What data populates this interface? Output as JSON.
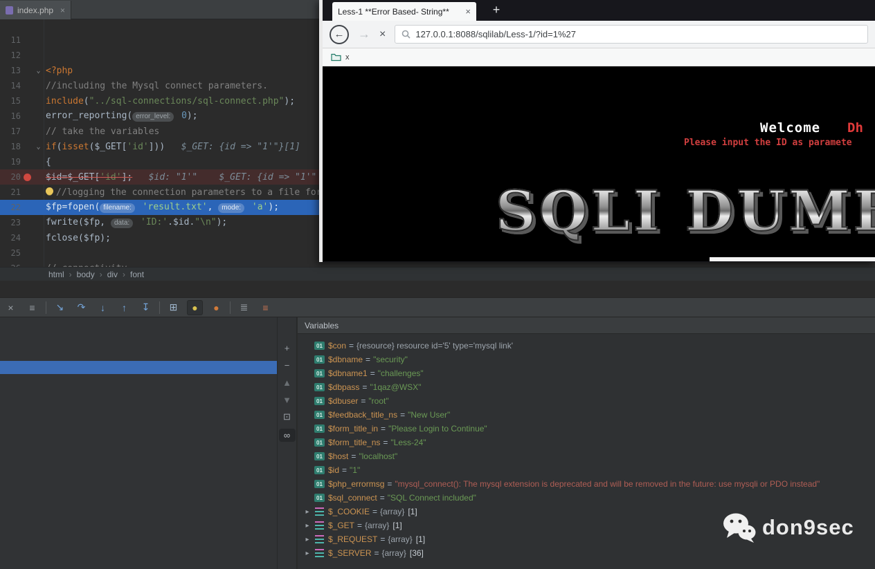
{
  "colors": {
    "exec_line": "#2b65b8",
    "breakpoint_line": "#442c2c",
    "selection_blue": "#3b6cb5",
    "notice_red": "#d23f3f",
    "string_green": "#6a9955",
    "name_orange": "#cc9452"
  },
  "icons": {
    "fold": "⌄",
    "chevron": "▸",
    "crumb_sep": "›",
    "scalar_badge": "01"
  },
  "ide": {
    "tab_bar": {
      "active_tab": "index.php",
      "close": "×"
    },
    "breadcrumbs": [
      "html",
      "body",
      "div",
      "font"
    ],
    "editor": {
      "lines": [
        {
          "num": "11",
          "segs": []
        },
        {
          "num": "12",
          "segs": []
        },
        {
          "num": "13",
          "fold": true,
          "segs": [
            {
              "k": "kw",
              "t": "<?php"
            }
          ]
        },
        {
          "num": "14",
          "segs": [
            {
              "k": "cm",
              "t": "//including the Mysql connect parameters."
            }
          ]
        },
        {
          "num": "15",
          "segs": [
            {
              "k": "kw",
              "t": "include"
            },
            {
              "k": "d",
              "t": "("
            },
            {
              "k": "str",
              "t": "\"../sql-connections/sql-connect.php\""
            },
            {
              "k": "d",
              "t": ");"
            }
          ]
        },
        {
          "num": "16",
          "segs": [
            {
              "k": "d",
              "t": "error_reporting("
            },
            {
              "k": "pill",
              "t": "error_level:"
            },
            {
              "k": "d",
              "t": " "
            },
            {
              "k": "num",
              "t": "0"
            },
            {
              "k": "d",
              "t": ");"
            }
          ]
        },
        {
          "num": "17",
          "segs": [
            {
              "k": "cm",
              "t": "// take the variables"
            }
          ]
        },
        {
          "num": "18",
          "fold": true,
          "segs": [
            {
              "k": "kw",
              "t": "if"
            },
            {
              "k": "d",
              "t": "("
            },
            {
              "k": "kw",
              "t": "isset"
            },
            {
              "k": "d",
              "t": "("
            },
            {
              "k": "v",
              "t": "$_GET"
            },
            {
              "k": "d",
              "t": "["
            },
            {
              "k": "str",
              "t": "'id'"
            },
            {
              "k": "d",
              "t": "]))"
            },
            {
              "k": "dbg",
              "t": "   $_GET: {id => \"1'\"}[1]"
            }
          ]
        },
        {
          "num": "19",
          "segs": [
            {
              "k": "d",
              "t": "{"
            }
          ]
        },
        {
          "num": "20",
          "bp": true,
          "segs": [
            {
              "k": "v",
              "s": 1,
              "t": "$id"
            },
            {
              "k": "d",
              "s": 1,
              "t": "="
            },
            {
              "k": "v",
              "s": 1,
              "t": "$_GET"
            },
            {
              "k": "d",
              "s": 1,
              "t": "["
            },
            {
              "k": "str",
              "s": 1,
              "t": "'id'"
            },
            {
              "k": "d",
              "s": 1,
              "t": "];"
            },
            {
              "k": "dbg",
              "t": "   $id: \"1'\"    $_GET: {id => \"1'\""
            }
          ]
        },
        {
          "num": "21",
          "bulb": true,
          "segs": [
            {
              "k": "cm",
              "t": "//logging the connection parameters to a file for "
            }
          ]
        },
        {
          "num": "22",
          "exec": true,
          "segs": [
            {
              "k": "v",
              "t": "$fp"
            },
            {
              "k": "d",
              "t": "=fopen("
            },
            {
              "k": "pill",
              "t": "filename:"
            },
            {
              "k": "str",
              "t": " 'result.txt'"
            },
            {
              "k": "d",
              "t": ", "
            },
            {
              "k": "pill",
              "t": "mode:"
            },
            {
              "k": "str",
              "t": " 'a'"
            },
            {
              "k": "d",
              "t": ");"
            }
          ]
        },
        {
          "num": "23",
          "segs": [
            {
              "k": "d",
              "t": "fwrite("
            },
            {
              "k": "v",
              "t": "$fp"
            },
            {
              "k": "d",
              "t": ", "
            },
            {
              "k": "pill",
              "t": "data:"
            },
            {
              "k": "str",
              "t": " 'ID:'"
            },
            {
              "k": "d",
              "t": "."
            },
            {
              "k": "v",
              "t": "$id"
            },
            {
              "k": "d",
              "t": "."
            },
            {
              "k": "str",
              "t": "\"\\n\""
            },
            {
              "k": "d",
              "t": ");"
            }
          ]
        },
        {
          "num": "24",
          "segs": [
            {
              "k": "d",
              "t": "fclose("
            },
            {
              "k": "v",
              "t": "$fp"
            },
            {
              "k": "d",
              "t": ");"
            }
          ]
        },
        {
          "num": "25",
          "segs": []
        },
        {
          "num": "26",
          "segs": [
            {
              "k": "cm",
              "t": "// connectivity"
            }
          ]
        }
      ]
    }
  },
  "browser": {
    "tab_title": "Less-1 **Error Based- String**",
    "tab_close": "×",
    "new_tab": "+",
    "back": "←",
    "forward": "→",
    "stop": "×",
    "url": "127.0.0.1:8088/sqlilab/Less-1/?id=1%27",
    "bookmark_label": "x",
    "page": {
      "welcome": "Welcome",
      "welcome_name": "Dh",
      "notice": "Please input the ID as paramete",
      "banner": "SQLI DUMB"
    }
  },
  "debugger": {
    "variables_header": "Variables",
    "toolbar": [
      {
        "name": "close-icon",
        "glyph": "×",
        "color": "#9aa0a6"
      },
      {
        "name": "menu-icon",
        "glyph": "≡",
        "color": "#9aa0a6"
      },
      {
        "sep": true
      },
      {
        "name": "show-execution-point-icon",
        "glyph": "↘",
        "color": "#74a4d8"
      },
      {
        "name": "step-over-icon",
        "glyph": "↷",
        "color": "#74a4d8"
      },
      {
        "name": "step-into-icon",
        "glyph": "↓",
        "color": "#74a4d8"
      },
      {
        "name": "step-out-icon",
        "glyph": "↑",
        "color": "#74a4d8"
      },
      {
        "name": "run-to-cursor-icon",
        "glyph": "↧",
        "color": "#74a4d8"
      },
      {
        "sep": true
      },
      {
        "name": "evaluate-expression-icon",
        "glyph": "⊞",
        "color": "#9fb6cc"
      },
      {
        "name": "mute-breakpoints-icon",
        "glyph": "●",
        "color": "#d8c14f",
        "active": true
      },
      {
        "name": "view-breakpoints-icon",
        "glyph": "●",
        "color": "#d07a3a"
      },
      {
        "sep": true
      },
      {
        "name": "threads-icon",
        "glyph": "≣",
        "color": "#9aa0a6"
      },
      {
        "name": "layout-icon",
        "glyph": "≡",
        "color": "#c77452"
      }
    ],
    "side_toolbar": [
      {
        "name": "add-watch-icon",
        "glyph": "+",
        "color": "#9aa0a6"
      },
      {
        "name": "remove-watch-icon",
        "glyph": "−",
        "color": "#9aa0a6"
      },
      {
        "name": "move-up-icon",
        "glyph": "▲",
        "color": "#6a6f73"
      },
      {
        "name": "move-down-icon",
        "glyph": "▼",
        "color": "#6a6f73"
      },
      {
        "name": "duplicate-icon",
        "glyph": "⊡",
        "color": "#9aa0a6"
      },
      {
        "name": "show-watches-icon",
        "glyph": "∞",
        "color": "#b9bec2",
        "active": true
      }
    ],
    "variables": [
      {
        "name": "$con",
        "kind": "plain",
        "value": "{resource} resource id='5' type='mysql link'"
      },
      {
        "name": "$dbname",
        "kind": "string",
        "value": "\"security\""
      },
      {
        "name": "$dbname1",
        "kind": "string",
        "value": "\"challenges\""
      },
      {
        "name": "$dbpass",
        "kind": "string",
        "value": "\"1qaz@WSX\""
      },
      {
        "name": "$dbuser",
        "kind": "string",
        "value": "\"root\""
      },
      {
        "name": "$feedback_title_ns",
        "kind": "string",
        "value": "\"New User\""
      },
      {
        "name": "$form_title_in",
        "kind": "string",
        "value": "\"Please Login to Continue\""
      },
      {
        "name": "$form_title_ns",
        "kind": "string",
        "value": "\"Less-24\""
      },
      {
        "name": "$host",
        "kind": "string",
        "value": "\"localhost\""
      },
      {
        "name": "$id",
        "kind": "string",
        "value": "\"1\""
      },
      {
        "name": "$php_errormsg",
        "kind": "error",
        "value": "\"mysql_connect(): The mysql extension is deprecated and will be removed in the future: use mysqli or PDO instead\""
      },
      {
        "name": "$sql_connect",
        "kind": "string",
        "value": "\"SQL Connect included\""
      },
      {
        "name": "$_COOKIE",
        "kind": "array",
        "value": "{array}",
        "count": "[1]"
      },
      {
        "name": "$_GET",
        "kind": "array",
        "value": "{array}",
        "count": "[1]"
      },
      {
        "name": "$_REQUEST",
        "kind": "array",
        "value": "{array}",
        "count": "[1]"
      },
      {
        "name": "$_SERVER",
        "kind": "array",
        "value": "{array}",
        "count": "[36]"
      }
    ]
  },
  "watermark": {
    "text": "don9sec"
  }
}
